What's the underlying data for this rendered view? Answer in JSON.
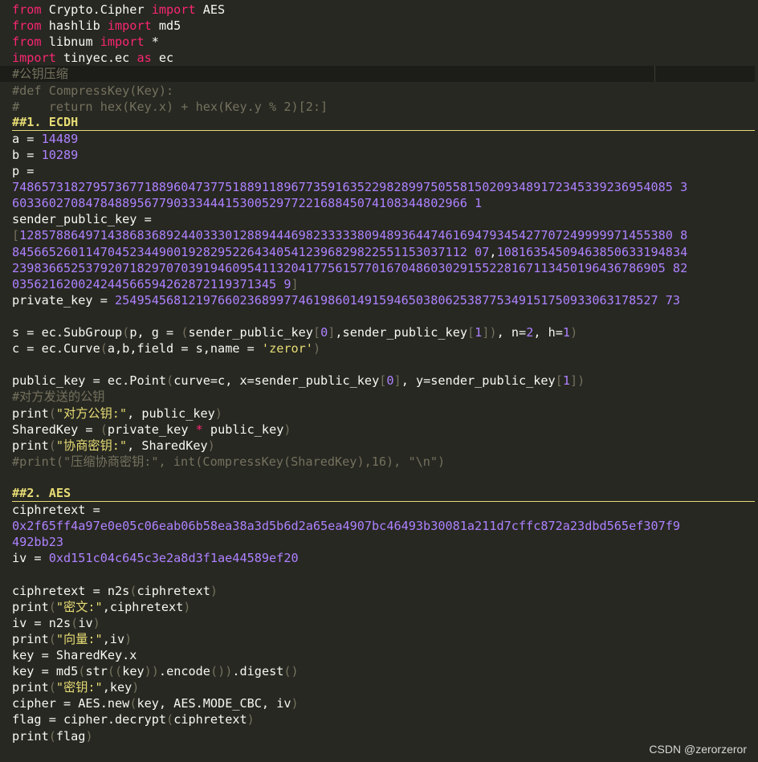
{
  "editor": {
    "lines": [
      {
        "current": false,
        "heading": false,
        "tokens": [
          [
            "kw",
            "from"
          ],
          [
            "pl",
            " Crypto.Cipher "
          ],
          [
            "kw",
            "import"
          ],
          [
            "pl",
            " AES"
          ]
        ]
      },
      {
        "current": false,
        "heading": false,
        "tokens": [
          [
            "kw",
            "from"
          ],
          [
            "pl",
            " hashlib "
          ],
          [
            "kw",
            "import"
          ],
          [
            "pl",
            " md5"
          ]
        ]
      },
      {
        "current": false,
        "heading": false,
        "tokens": [
          [
            "kw",
            "from"
          ],
          [
            "pl",
            " libnum "
          ],
          [
            "kw",
            "import"
          ],
          [
            "pl",
            " *"
          ]
        ]
      },
      {
        "current": false,
        "heading": false,
        "tokens": [
          [
            "kw",
            "import"
          ],
          [
            "pl",
            " tinyec.ec "
          ],
          [
            "kw",
            "as"
          ],
          [
            "pl",
            " ec"
          ]
        ]
      },
      {
        "current": true,
        "heading": false,
        "tokens": [
          [
            "cm",
            "#公钥压缩"
          ]
        ]
      },
      {
        "current": false,
        "heading": false,
        "tokens": [
          [
            "cm",
            "#def CompressKey(Key):"
          ]
        ]
      },
      {
        "current": false,
        "heading": false,
        "tokens": [
          [
            "cm",
            "#    return hex(Key.x) + hex(Key.y % 2)[2:]"
          ]
        ]
      },
      {
        "current": false,
        "heading": true,
        "tokens": [
          [
            "md",
            "##1. ECDH"
          ]
        ]
      },
      {
        "current": false,
        "heading": false,
        "tokens": [
          [
            "pl",
            "a = "
          ],
          [
            "num",
            "14489"
          ]
        ]
      },
      {
        "current": false,
        "heading": false,
        "tokens": [
          [
            "pl",
            "b = "
          ],
          [
            "num",
            "10289"
          ]
        ]
      },
      {
        "current": false,
        "heading": false,
        "tokens": [
          [
            "pl",
            "p = "
          ]
        ]
      },
      {
        "current": false,
        "heading": false,
        "tokens": [
          [
            "num",
            "748657318279573677188960473775188911896773591635229828997505581502093489172345339236954085 3"
          ]
        ]
      },
      {
        "current": false,
        "heading": false,
        "tokens": [
          [
            "num",
            "60336027084784889567790333444153005297722168845074108344802966 1"
          ]
        ]
      },
      {
        "current": false,
        "heading": false,
        "tokens": [
          [
            "pl",
            "sender_public_key = "
          ]
        ]
      },
      {
        "current": false,
        "heading": false,
        "tokens": [
          [
            "br",
            "["
          ],
          [
            "num",
            "12857886497143868368924403330128894446982333338094893644746169479345427707249999971455380 8"
          ]
        ]
      },
      {
        "current": false,
        "heading": false,
        "tokens": [
          [
            "num",
            "84566526011470452344900192829522643405412396829822551153037112 07"
          ],
          [
            "pl",
            ","
          ],
          [
            "num",
            "10816354509463850633194834"
          ]
        ]
      },
      {
        "current": false,
        "heading": false,
        "tokens": [
          [
            "num",
            "23983665253792071829707039194609541132041775615770167048603029155228167113450196436786905 82"
          ]
        ]
      },
      {
        "current": false,
        "heading": false,
        "tokens": [
          [
            "num",
            "035621620024244566594262872119371345 9"
          ],
          [
            "br",
            "]"
          ]
        ]
      },
      {
        "current": false,
        "heading": false,
        "tokens": [
          [
            "pl",
            "private_key = "
          ],
          [
            "num",
            "25495456812197660236899774619860149159465038062538775349151750933063178527 73"
          ]
        ]
      },
      {
        "current": false,
        "heading": false,
        "tokens": [
          [
            "pl",
            ""
          ]
        ]
      },
      {
        "current": false,
        "heading": false,
        "tokens": [
          [
            "pl",
            "s = ec.SubGroup"
          ],
          [
            "br",
            "("
          ],
          [
            "pl",
            "p, g = "
          ],
          [
            "br",
            "("
          ],
          [
            "pl",
            "sender_public_key"
          ],
          [
            "br",
            "["
          ],
          [
            "num",
            "0"
          ],
          [
            "br",
            "]"
          ],
          [
            "pl",
            ",sender_public_key"
          ],
          [
            "br",
            "["
          ],
          [
            "num",
            "1"
          ],
          [
            "br",
            "])"
          ],
          [
            "pl",
            ", n="
          ],
          [
            "num",
            "2"
          ],
          [
            "pl",
            ", h="
          ],
          [
            "num",
            "1"
          ],
          [
            "br",
            ")"
          ]
        ]
      },
      {
        "current": false,
        "heading": false,
        "tokens": [
          [
            "pl",
            "c = ec.Curve"
          ],
          [
            "br",
            "("
          ],
          [
            "pl",
            "a,b,field = s,name = "
          ],
          [
            "str",
            "'zeror'"
          ],
          [
            "br",
            ")"
          ]
        ]
      },
      {
        "current": false,
        "heading": false,
        "tokens": [
          [
            "pl",
            ""
          ]
        ]
      },
      {
        "current": false,
        "heading": false,
        "tokens": [
          [
            "pl",
            "public_key = ec.Point"
          ],
          [
            "br",
            "("
          ],
          [
            "pl",
            "curve=c, x=sender_public_key"
          ],
          [
            "br",
            "["
          ],
          [
            "num",
            "0"
          ],
          [
            "br",
            "]"
          ],
          [
            "pl",
            ", y=sender_public_key"
          ],
          [
            "br",
            "["
          ],
          [
            "num",
            "1"
          ],
          [
            "br",
            "])"
          ]
        ]
      },
      {
        "current": false,
        "heading": false,
        "tokens": [
          [
            "cm",
            "#对方发送的公钥"
          ]
        ]
      },
      {
        "current": false,
        "heading": false,
        "tokens": [
          [
            "pl",
            "print"
          ],
          [
            "br",
            "("
          ],
          [
            "str",
            "\"对方公钥:\""
          ],
          [
            "pl",
            ", public_key"
          ],
          [
            "br",
            ")"
          ]
        ]
      },
      {
        "current": false,
        "heading": false,
        "tokens": [
          [
            "pl",
            "SharedKey = "
          ],
          [
            "br",
            "("
          ],
          [
            "pl",
            "private_key "
          ],
          [
            "kw",
            "*"
          ],
          [
            "pl",
            " public_key"
          ],
          [
            "br",
            ")"
          ]
        ]
      },
      {
        "current": false,
        "heading": false,
        "tokens": [
          [
            "pl",
            "print"
          ],
          [
            "br",
            "("
          ],
          [
            "str",
            "\"协商密钥:\""
          ],
          [
            "pl",
            ", SharedKey"
          ],
          [
            "br",
            ")"
          ]
        ]
      },
      {
        "current": false,
        "heading": false,
        "tokens": [
          [
            "cm",
            "#print(\"压缩协商密钥:\", int(CompressKey(SharedKey),16), \"\\n\")"
          ]
        ]
      },
      {
        "current": false,
        "heading": false,
        "tokens": [
          [
            "pl",
            ""
          ]
        ]
      },
      {
        "current": false,
        "heading": true,
        "tokens": [
          [
            "md",
            "##2. AES"
          ]
        ]
      },
      {
        "current": false,
        "heading": false,
        "tokens": [
          [
            "pl",
            "ciphretext = "
          ]
        ]
      },
      {
        "current": false,
        "heading": false,
        "tokens": [
          [
            "num",
            "0x2f65ff4a97e0e05c06eab06b58ea38a3d5b6d2a65ea4907bc46493b30081a211d7cffc872a23dbd565ef307f9"
          ]
        ]
      },
      {
        "current": false,
        "heading": false,
        "tokens": [
          [
            "num",
            "492bb23"
          ]
        ]
      },
      {
        "current": false,
        "heading": false,
        "tokens": [
          [
            "pl",
            "iv = "
          ],
          [
            "num",
            "0xd151c04c645c3e2a8d3f1ae44589ef20"
          ]
        ]
      },
      {
        "current": false,
        "heading": false,
        "tokens": [
          [
            "pl",
            ""
          ]
        ]
      },
      {
        "current": false,
        "heading": false,
        "tokens": [
          [
            "pl",
            "ciphretext = n2s"
          ],
          [
            "br",
            "("
          ],
          [
            "pl",
            "ciphretext"
          ],
          [
            "br",
            ")"
          ]
        ]
      },
      {
        "current": false,
        "heading": false,
        "tokens": [
          [
            "pl",
            "print"
          ],
          [
            "br",
            "("
          ],
          [
            "str",
            "\"密文:\""
          ],
          [
            "pl",
            ",ciphretext"
          ],
          [
            "br",
            ")"
          ]
        ]
      },
      {
        "current": false,
        "heading": false,
        "tokens": [
          [
            "pl",
            "iv = n2s"
          ],
          [
            "br",
            "("
          ],
          [
            "pl",
            "iv"
          ],
          [
            "br",
            ")"
          ]
        ]
      },
      {
        "current": false,
        "heading": false,
        "tokens": [
          [
            "pl",
            "print"
          ],
          [
            "br",
            "("
          ],
          [
            "str",
            "\"向量:\""
          ],
          [
            "pl",
            ",iv"
          ],
          [
            "br",
            ")"
          ]
        ]
      },
      {
        "current": false,
        "heading": false,
        "tokens": [
          [
            "pl",
            "key = SharedKey.x"
          ]
        ]
      },
      {
        "current": false,
        "heading": false,
        "tokens": [
          [
            "pl",
            "key = md5"
          ],
          [
            "br",
            "("
          ],
          [
            "pl",
            "str"
          ],
          [
            "br",
            "(("
          ],
          [
            "pl",
            "key"
          ],
          [
            "br",
            "))"
          ],
          [
            "pl",
            ".encode"
          ],
          [
            "br",
            "())"
          ],
          [
            "pl",
            ".digest"
          ],
          [
            "br",
            "()"
          ]
        ]
      },
      {
        "current": false,
        "heading": false,
        "tokens": [
          [
            "pl",
            "print"
          ],
          [
            "br",
            "("
          ],
          [
            "str",
            "\"密钥:\""
          ],
          [
            "pl",
            ",key"
          ],
          [
            "br",
            ")"
          ]
        ]
      },
      {
        "current": false,
        "heading": false,
        "tokens": [
          [
            "pl",
            "cipher = AES.new"
          ],
          [
            "br",
            "("
          ],
          [
            "pl",
            "key, AES.MODE_CBC, iv"
          ],
          [
            "br",
            ")"
          ]
        ]
      },
      {
        "current": false,
        "heading": false,
        "tokens": [
          [
            "pl",
            "flag = cipher.decrypt"
          ],
          [
            "br",
            "("
          ],
          [
            "pl",
            "ciphretext"
          ],
          [
            "br",
            ")"
          ]
        ]
      },
      {
        "current": false,
        "heading": false,
        "tokens": [
          [
            "pl",
            "print"
          ],
          [
            "br",
            "("
          ],
          [
            "pl",
            "flag"
          ],
          [
            "br",
            ")"
          ]
        ]
      }
    ]
  },
  "watermark": "CSDN @zerorzeror"
}
